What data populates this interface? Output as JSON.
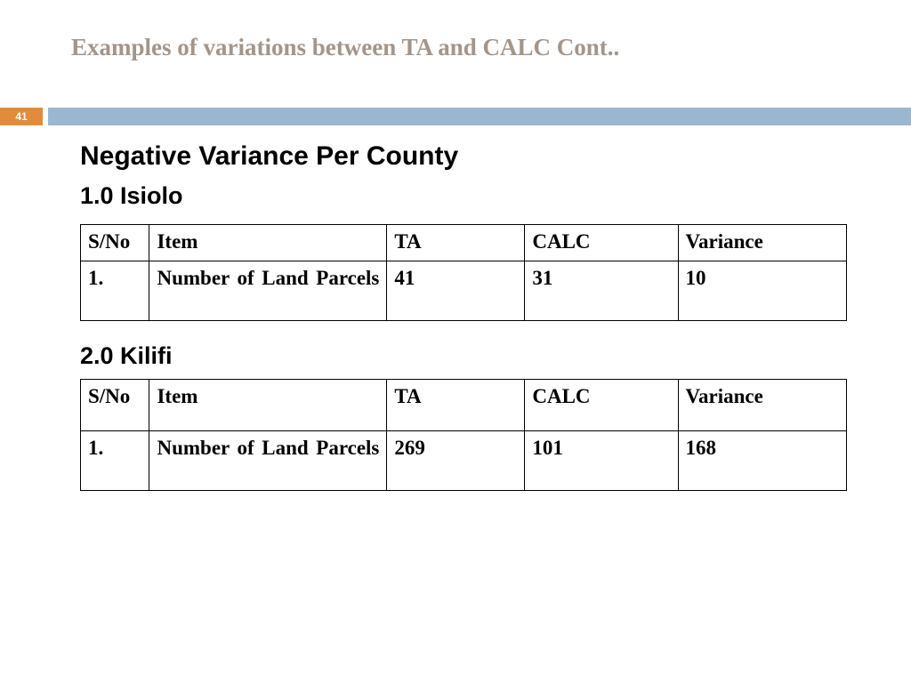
{
  "page_number": "41",
  "title": "Examples of variations between TA and CALC Cont..",
  "heading_main": "Negative Variance Per County",
  "section1": {
    "heading": "1.0 Isiolo",
    "headers": {
      "sno": "S/No",
      "item": "Item",
      "ta": "TA",
      "calc": "CALC",
      "var": "Variance"
    },
    "row": {
      "sno": "1.",
      "item": "Number of Land Parcels",
      "ta": "41",
      "calc": " 31",
      "var": "10"
    }
  },
  "section2": {
    "heading": "2.0 Kilifi",
    "headers": {
      "sno": "S/No",
      "item": "Item",
      "ta": "TA",
      "calc": "CALC",
      "var": "Variance"
    },
    "row": {
      "sno": "1.",
      "item": "Number of Land Parcels",
      "ta": "269",
      "calc": "101",
      "var": "168"
    }
  },
  "chart_data": [
    {
      "type": "table",
      "title": "1.0 Isiolo",
      "columns": [
        "S/No",
        "Item",
        "TA",
        "CALC",
        "Variance"
      ],
      "rows": [
        [
          "1.",
          "Number of Land Parcels",
          41,
          31,
          10
        ]
      ]
    },
    {
      "type": "table",
      "title": "2.0 Kilifi",
      "columns": [
        "S/No",
        "Item",
        "TA",
        "CALC",
        "Variance"
      ],
      "rows": [
        [
          "1.",
          "Number of Land Parcels",
          269,
          101,
          168
        ]
      ]
    }
  ]
}
